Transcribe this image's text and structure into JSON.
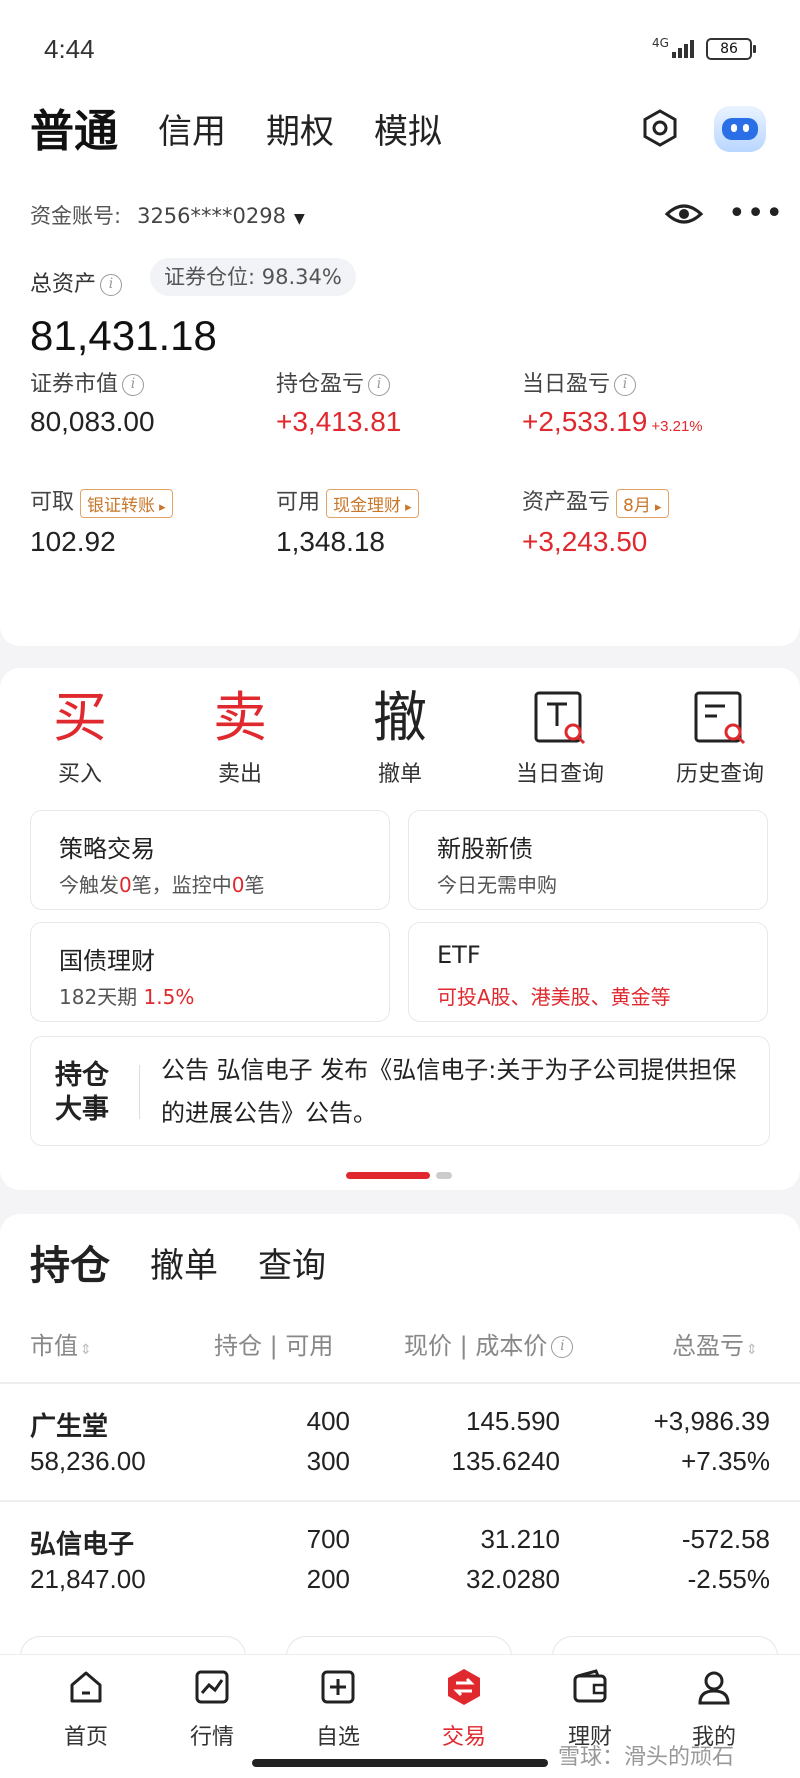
{
  "status_bar": {
    "time": "4:44",
    "network": "4G",
    "battery": "86"
  },
  "account_tabs": [
    "普通",
    "信用",
    "期权",
    "模拟"
  ],
  "account": {
    "label": "资金账号:",
    "number": "3256****0298",
    "total_assets_label": "总资产",
    "position_ratio": "证券仓位: 98.34%",
    "total_assets": "81,431.18"
  },
  "stats": {
    "market_value": {
      "label": "证券市值",
      "value": "80,083.00"
    },
    "holding_pnl": {
      "label": "持仓盈亏",
      "value": "+3,413.81"
    },
    "daily_pnl": {
      "label": "当日盈亏",
      "value": "+2,533.19",
      "pct": "+3.21%"
    },
    "withdrawable": {
      "label": "可取",
      "value": "102.92",
      "button": "银证转账"
    },
    "available": {
      "label": "可用",
      "value": "1,348.18",
      "button": "现金理财"
    },
    "asset_pnl": {
      "label": "资产盈亏",
      "value": "+3,243.50",
      "button": "8月"
    }
  },
  "quick_actions": {
    "buy": {
      "glyph": "买",
      "label": "买入"
    },
    "sell": {
      "glyph": "卖",
      "label": "卖出"
    },
    "cancel": {
      "glyph": "撤",
      "label": "撤单"
    },
    "today_query": {
      "label": "当日查询"
    },
    "history_query": {
      "label": "历史查询"
    }
  },
  "cards": {
    "strategy": {
      "title": "策略交易",
      "sub_a": "今触发",
      "count_a": "0",
      "sub_b": "笔，监控中",
      "count_b": "0",
      "sub_c": "笔"
    },
    "ipo": {
      "title": "新股新债",
      "sub": "今日无需申购"
    },
    "bond": {
      "title": "国债理财",
      "sub": "182天期",
      "rate": "1.5%"
    },
    "etf": {
      "title": "ETF",
      "sub": "可投A股、港美股、黄金等"
    }
  },
  "news": {
    "badge_1": "持仓",
    "badge_2": "大事",
    "text": "公告 弘信电子 发布《弘信电子:关于为子公司提供担保的进展公告》公告。"
  },
  "holdings_tabs": [
    "持仓",
    "撤单",
    "查询"
  ],
  "holdings_header": {
    "market_value": "市值",
    "position": "持仓",
    "available": "可用",
    "price": "现价",
    "cost": "成本价",
    "total_pnl": "总盈亏"
  },
  "holdings": [
    {
      "name": "广生堂",
      "market_value": "58,236.00",
      "position": "400",
      "available": "300",
      "price": "145.590",
      "cost": "135.6240",
      "pnl": "+3,986.39",
      "pnl_pct": "+7.35%"
    },
    {
      "name": "弘信电子",
      "market_value": "21,847.00",
      "position": "700",
      "available": "200",
      "price": "31.210",
      "cost": "32.0280",
      "pnl": "-572.58",
      "pnl_pct": "-2.55%"
    }
  ],
  "nav": [
    "首页",
    "行情",
    "自选",
    "交易",
    "理财",
    "我的"
  ],
  "watermark": "雪球：滑头的顽石",
  "colors": {
    "accent_red": "#e0292e",
    "loss_green": "#1a9a62",
    "tag_orange": "#c8772a"
  }
}
